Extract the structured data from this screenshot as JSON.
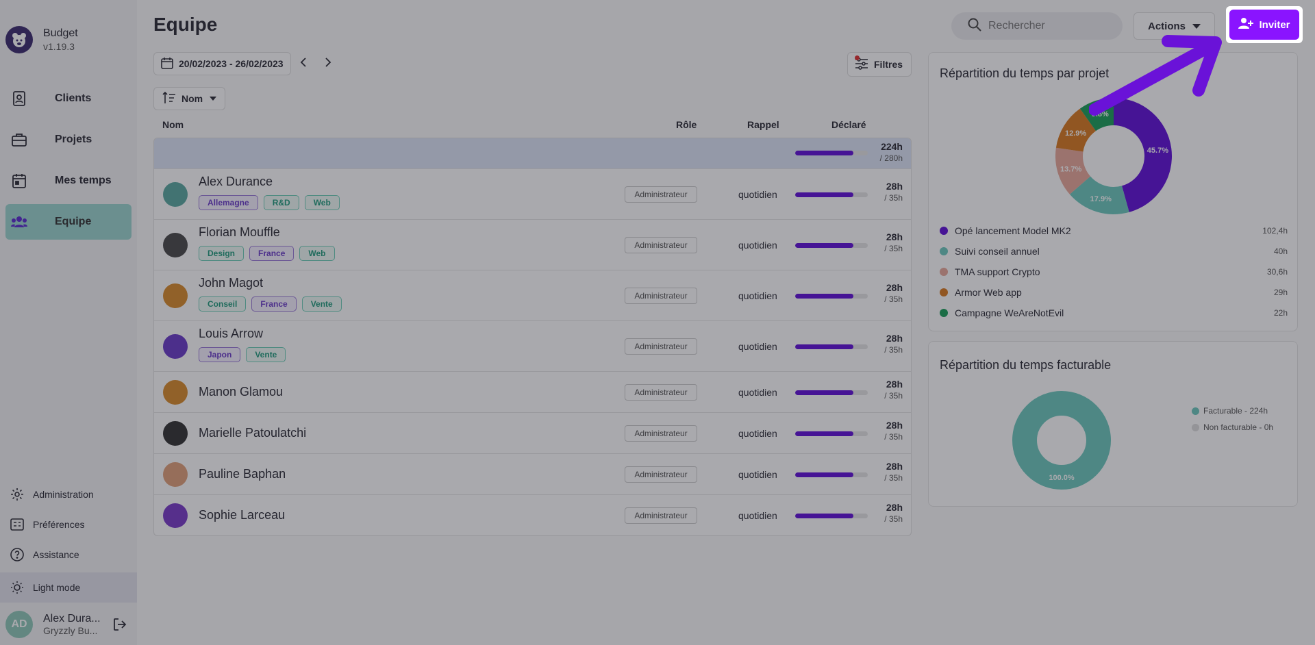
{
  "app": {
    "name": "Budget",
    "version": "v1.19.3"
  },
  "nav": [
    {
      "label": "Clients",
      "icon": "contact-book-icon",
      "active": false
    },
    {
      "label": "Projets",
      "icon": "briefcase-icon",
      "active": false
    },
    {
      "label": "Mes temps",
      "icon": "calendar-icon",
      "active": false
    },
    {
      "label": "Equipe",
      "icon": "team-icon",
      "active": true
    }
  ],
  "bottom_nav": [
    {
      "label": "Administration",
      "icon": "gear-icon"
    },
    {
      "label": "Préférences",
      "icon": "preferences-icon"
    },
    {
      "label": "Assistance",
      "icon": "help-icon"
    },
    {
      "label": "Light mode",
      "icon": "sun-icon"
    }
  ],
  "user": {
    "name": "Alex Dura...",
    "org": "Gryzzly Bu..."
  },
  "page": {
    "title": "Equipe"
  },
  "search": {
    "placeholder": "Rechercher"
  },
  "toolbar": {
    "actions_label": "Actions",
    "invite_label": "Inviter",
    "filters_label": "Filtres",
    "sort_label": "Nom"
  },
  "date_range": "20/02/2023 - 26/02/2023",
  "table": {
    "headers": {
      "name": "Nom",
      "role": "Rôle",
      "reminder": "Rappel",
      "declared": "Déclaré"
    },
    "total": {
      "declared": "224h",
      "expected": "/ 280h",
      "fraction": 0.8
    },
    "rows": [
      {
        "name": "Alex Durance",
        "tags": [
          {
            "label": "Allemagne",
            "color": "purple"
          },
          {
            "label": "R&D",
            "color": "green"
          },
          {
            "label": "Web",
            "color": "green"
          }
        ],
        "role": "Administrateur",
        "reminder": "quotidien",
        "declared": "28h",
        "expected": "/ 35h",
        "fraction": 0.8,
        "avatar_color": "#5aa9a0"
      },
      {
        "name": "Florian Mouffle",
        "tags": [
          {
            "label": "Design",
            "color": "green"
          },
          {
            "label": "France",
            "color": "purple"
          },
          {
            "label": "Web",
            "color": "green"
          }
        ],
        "role": "Administrateur",
        "reminder": "quotidien",
        "declared": "28h",
        "expected": "/ 35h",
        "fraction": 0.8,
        "avatar_color": "#4a4a4a"
      },
      {
        "name": "John Magot",
        "tags": [
          {
            "label": "Conseil",
            "color": "green"
          },
          {
            "label": "France",
            "color": "purple"
          },
          {
            "label": "Vente",
            "color": "green"
          }
        ],
        "role": "Administrateur",
        "reminder": "quotidien",
        "declared": "28h",
        "expected": "/ 35h",
        "fraction": 0.8,
        "avatar_color": "#d98b2b"
      },
      {
        "name": "Louis Arrow",
        "tags": [
          {
            "label": "Japon",
            "color": "purple"
          },
          {
            "label": "Vente",
            "color": "green"
          }
        ],
        "role": "Administrateur",
        "reminder": "quotidien",
        "declared": "28h",
        "expected": "/ 35h",
        "fraction": 0.8,
        "avatar_color": "#6a3bc8"
      },
      {
        "name": "Manon Glamou",
        "tags": [],
        "role": "Administrateur",
        "reminder": "quotidien",
        "declared": "28h",
        "expected": "/ 35h",
        "fraction": 0.8,
        "avatar_color": "#d98b2b"
      },
      {
        "name": "Marielle Patoulatchi",
        "tags": [],
        "role": "Administrateur",
        "reminder": "quotidien",
        "declared": "28h",
        "expected": "/ 35h",
        "fraction": 0.8,
        "avatar_color": "#333333"
      },
      {
        "name": "Pauline Baphan",
        "tags": [],
        "role": "Administrateur",
        "reminder": "quotidien",
        "declared": "28h",
        "expected": "/ 35h",
        "fraction": 0.8,
        "avatar_color": "#e0a07a"
      },
      {
        "name": "Sophie Larceau",
        "tags": [],
        "role": "Administrateur",
        "reminder": "quotidien",
        "declared": "28h",
        "expected": "/ 35h",
        "fraction": 0.8,
        "avatar_color": "#7a3bc8"
      }
    ]
  },
  "charts": {
    "project": {
      "title": "Répartition du temps par projet",
      "items": [
        {
          "name": "Opé lancement Model MK2",
          "value": "102,4h",
          "pct": 45.7,
          "pct_label": "45.7%",
          "color": "#6010d8"
        },
        {
          "name": "Suivi conseil annuel",
          "value": "40h",
          "pct": 17.9,
          "pct_label": "17.9%",
          "color": "#6cc9bd"
        },
        {
          "name": "TMA support Crypto",
          "value": "30,6h",
          "pct": 13.7,
          "pct_label": "13.7%",
          "color": "#e8a99a"
        },
        {
          "name": "Armor Web app",
          "value": "29h",
          "pct": 12.9,
          "pct_label": "12.9%",
          "color": "#d97a1f"
        },
        {
          "name": "Campagne WeAreNotEvil",
          "value": "22h",
          "pct": 9.8,
          "pct_label": "9.8%",
          "color": "#1a9e5a"
        }
      ]
    },
    "billable": {
      "title": "Répartition du temps facturable",
      "items": [
        {
          "name": "Facturable - 224h",
          "pct": 100,
          "pct_label": "100.0%",
          "color": "#6cc9bd"
        },
        {
          "name": "Non facturable - 0h",
          "pct": 0,
          "pct_label": "",
          "color": "#dddddd"
        }
      ]
    }
  },
  "colors": {
    "accent": "#8a14ff",
    "active_nav": "#9bd6cf",
    "bar": "#6010d8"
  }
}
